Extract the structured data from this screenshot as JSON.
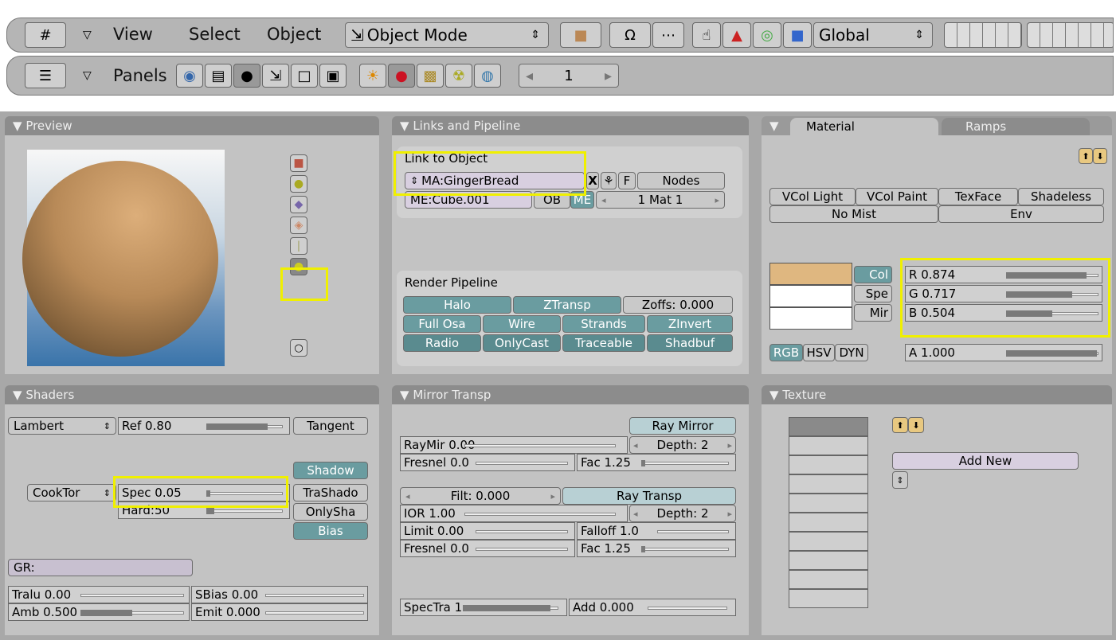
{
  "header": {
    "menus": [
      "View",
      "Select",
      "Object"
    ],
    "mode": "Object Mode",
    "orientation": "Global"
  },
  "buttons_header": {
    "panels": "Panels",
    "frame": "1"
  },
  "preview": {
    "title": "Preview"
  },
  "links": {
    "title": "Links and Pipeline",
    "link_to_object": "Link to Object",
    "material_name": "MA:GingerBread",
    "x": "X",
    "f": "F",
    "nodes": "Nodes",
    "mesh": "ME:Cube.001",
    "ob": "OB",
    "me": "ME",
    "mat": "1 Mat 1",
    "render_pipeline": "Render Pipeline",
    "halo": "Halo",
    "ztransp": "ZTransp",
    "zoffs": "Zoffs: 0.000",
    "fullosa": "Full Osa",
    "wire": "Wire",
    "strands": "Strands",
    "zinvert": "ZInvert",
    "radio": "Radio",
    "onlycast": "OnlyCast",
    "traceable": "Traceable",
    "shadbuf": "Shadbuf"
  },
  "material": {
    "tab_material": "Material",
    "tab_ramps": "Ramps",
    "vcol_light": "VCol Light",
    "vcol_paint": "VCol Paint",
    "texface": "TexFace",
    "shadeless": "Shadeless",
    "no_mist": "No Mist",
    "env": "Env",
    "col": "Col",
    "spe": "Spe",
    "mir": "Mir",
    "r": "R 0.874",
    "g": "G 0.717",
    "b": "B 0.504",
    "a": "A 1.000",
    "rgb": "RGB",
    "hsv": "HSV",
    "dyn": "DYN",
    "r_val": 0.874,
    "g_val": 0.717,
    "b_val": 0.504,
    "a_val": 1.0,
    "color": "#dfb780"
  },
  "shaders": {
    "title": "Shaders",
    "diffuse": "Lambert",
    "ref": "Ref  0.80",
    "tangent": "Tangent",
    "shadow": "Shadow",
    "spec_shader": "CookTor",
    "spec": "Spec 0.05",
    "trashado": "TraShado",
    "hard": "Hard:50",
    "onlysha": "OnlySha",
    "bias": "Bias",
    "gr": "GR:",
    "tralu": "Tralu 0.00",
    "sbias": "SBias 0.00",
    "amb": "Amb 0.500",
    "emit": "Emit 0.000",
    "ref_val": 0.8,
    "spec_val": 0.05,
    "amb_val": 0.5
  },
  "mirror": {
    "title": "Mirror Transp",
    "ray_mirror": "Ray Mirror",
    "raymir": "RayMir 0.00",
    "depth1": "Depth: 2",
    "fresnel1": "Fresnel 0.0",
    "fac1": "Fac 1.25",
    "filt": "Filt: 0.000",
    "ray_transp": "Ray Transp",
    "ior": "IOR 1.00",
    "depth2": "Depth: 2",
    "limit": "Limit 0.00",
    "falloff": "Falloff 1.0",
    "fresnel2": "Fresnel 0.0",
    "fac2": "Fac 1.25",
    "spectra": "SpecTra 1.",
    "add": "Add 0.000"
  },
  "texture": {
    "title": "Texture",
    "add_new": "Add New"
  }
}
